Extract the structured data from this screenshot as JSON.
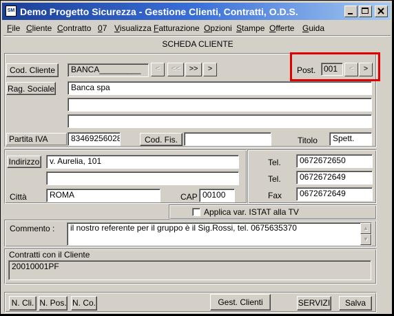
{
  "window": {
    "title": "Demo Progetto Sicurezza - Gestione Clienti, Contratti, O.D.S.",
    "icon_label": "SM"
  },
  "menu": [
    "File",
    "Cliente",
    "Contratto",
    "07",
    "Visualizza",
    "Fatturazione",
    "Opzioni",
    "Stampe",
    "Offerte",
    "Guida"
  ],
  "heading": "SCHEDA CLIENTE",
  "cliente": {
    "cod_label": "Cod. Cliente",
    "cod_value": "BANCA_________",
    "post_label": "Post.",
    "post_value": "001",
    "rag_label": "Rag. Sociale",
    "rag_lines": [
      "Banca spa",
      "",
      ""
    ],
    "piva_label": "Partita IVA",
    "piva_value": "83469256028",
    "codfis_label": "Cod. Fis.",
    "codfis_value": "",
    "titolo_label": "Titolo",
    "titolo_value": "Spett."
  },
  "nav": {
    "first": "<",
    "prev_fast": "<<",
    "next_fast": ">>",
    "last": ">",
    "post_prev": "<",
    "post_next": ">"
  },
  "indirizzo": {
    "label": "Indirizzo",
    "line1": "v. Aurelia, 101",
    "line2": "",
    "citta_label": "Città",
    "citta_value": "ROMA",
    "cap_label": "CAP",
    "cap_value": "00100"
  },
  "contatti": {
    "tel1_label": "Tel.",
    "tel1_value": "0672672650",
    "tel2_label": "Tel.",
    "tel2_value": "0672672649",
    "fax_label": "Fax",
    "fax_value": "0672672649"
  },
  "istat": {
    "label": "Applica var. ISTAT alla TV",
    "checked": false
  },
  "commento": {
    "label": "Commento :",
    "value": "il nostro referente per il gruppo è il Sig.Rossi, tel. 0675635370"
  },
  "contratti": {
    "label": "Contratti con il Cliente",
    "items": [
      "20010001PF"
    ]
  },
  "buttons": {
    "n_cli": "N. Cli.",
    "n_pos": "N. Pos.",
    "n_co": "N. Co.",
    "gest_clienti": "Gest. Clienti",
    "servizi": "SERVIZI",
    "salva": "Salva"
  }
}
